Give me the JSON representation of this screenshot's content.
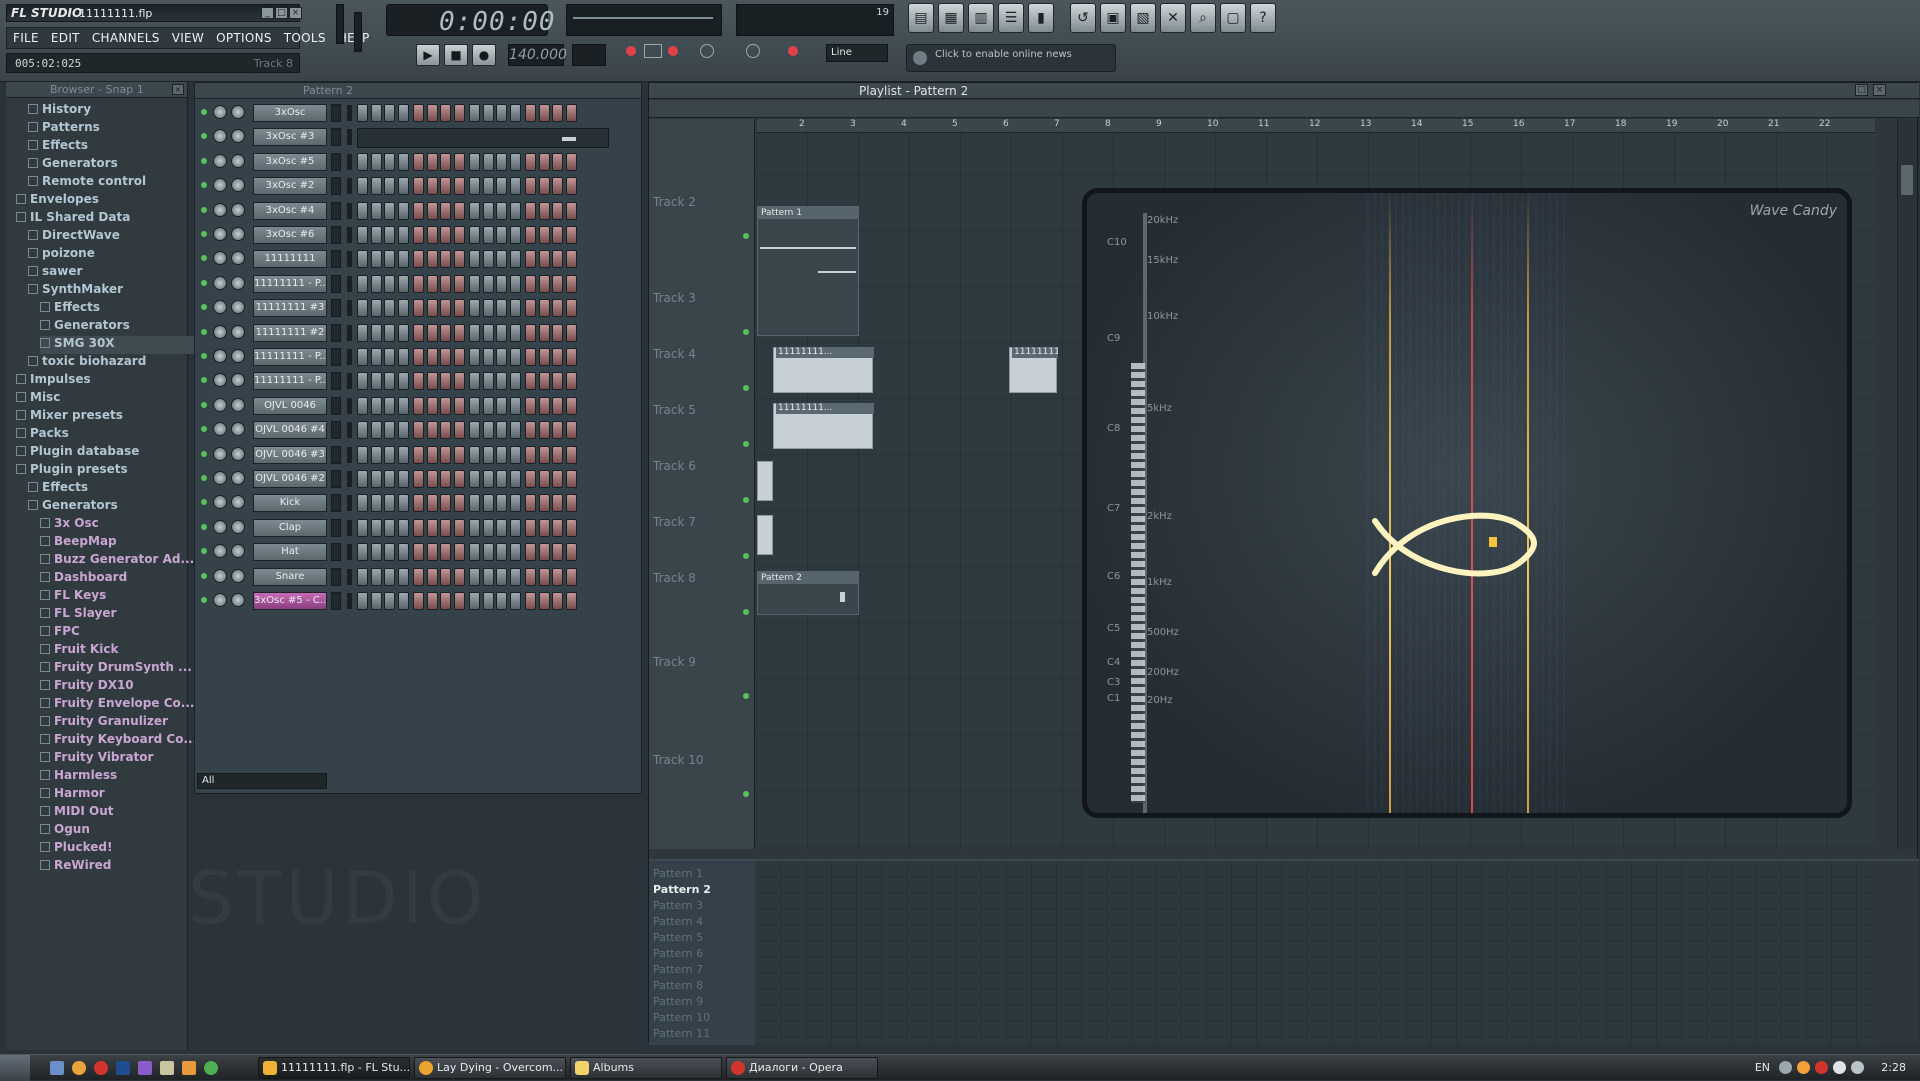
{
  "window": {
    "app_logo": "FL STUDIO",
    "project": "11111111.flp",
    "menu": [
      "FILE",
      "EDIT",
      "CHANNELS",
      "VIEW",
      "OPTIONS",
      "TOOLS",
      "HELP"
    ],
    "time_readout": "005:02:025",
    "track_readout": "Track 8"
  },
  "transport": {
    "clock": "0:00:00",
    "tempo": "140.000",
    "meters": "19",
    "snap": "Line",
    "news": "Click to enable online news",
    "play_icon": "play-icon",
    "stop_icon": "stop-icon",
    "record_icon": "record-icon"
  },
  "browser": {
    "title": "Browser - Snap 1",
    "items": [
      {
        "label": "History",
        "indent": 1
      },
      {
        "label": "Patterns",
        "indent": 1
      },
      {
        "label": "Effects",
        "indent": 1
      },
      {
        "label": "Generators",
        "indent": 1
      },
      {
        "label": "Remote control",
        "indent": 1
      },
      {
        "label": "Envelopes",
        "indent": 0
      },
      {
        "label": "IL Shared Data",
        "indent": 0
      },
      {
        "label": "DirectWave",
        "indent": 1
      },
      {
        "label": "poizone",
        "indent": 1
      },
      {
        "label": "sawer",
        "indent": 1
      },
      {
        "label": "SynthMaker",
        "indent": 1
      },
      {
        "label": "Effects",
        "indent": 2
      },
      {
        "label": "Generators",
        "indent": 2
      },
      {
        "label": "SMG 30X",
        "indent": 2
      },
      {
        "label": "toxic biohazard",
        "indent": 1
      },
      {
        "label": "Impulses",
        "indent": 0
      },
      {
        "label": "Misc",
        "indent": 0
      },
      {
        "label": "Mixer presets",
        "indent": 0
      },
      {
        "label": "Packs",
        "indent": 0
      },
      {
        "label": "Plugin database",
        "indent": 0
      },
      {
        "label": "Plugin presets",
        "indent": 0
      },
      {
        "label": "Effects",
        "indent": 1
      },
      {
        "label": "Generators",
        "indent": 1
      },
      {
        "label": "3x Osc",
        "indent": 2
      },
      {
        "label": "BeepMap",
        "indent": 2
      },
      {
        "label": "Buzz Generator Ad...",
        "indent": 2
      },
      {
        "label": "Dashboard",
        "indent": 2
      },
      {
        "label": "FL Keys",
        "indent": 2
      },
      {
        "label": "FL Slayer",
        "indent": 2
      },
      {
        "label": "FPC",
        "indent": 2
      },
      {
        "label": "Fruit Kick",
        "indent": 2
      },
      {
        "label": "Fruity DrumSynth ...",
        "indent": 2
      },
      {
        "label": "Fruity DX10",
        "indent": 2
      },
      {
        "label": "Fruity Envelope Co...",
        "indent": 2
      },
      {
        "label": "Fruity Granulizer",
        "indent": 2
      },
      {
        "label": "Fruity Keyboard Co...",
        "indent": 2
      },
      {
        "label": "Fruity Vibrator",
        "indent": 2
      },
      {
        "label": "Harmless",
        "indent": 2
      },
      {
        "label": "Harmor",
        "indent": 2
      },
      {
        "label": "MIDI Out",
        "indent": 2
      },
      {
        "label": "Ogun",
        "indent": 2
      },
      {
        "label": "Plucked!",
        "indent": 2
      },
      {
        "label": "ReWired",
        "indent": 2
      }
    ]
  },
  "channel_rack": {
    "pattern": "Pattern 2",
    "filter": "All",
    "channels": [
      "3xOsc",
      "3xOsc #3",
      "3xOsc #5",
      "3xOsc #2",
      "3xOsc #4",
      "3xOsc #6",
      "11111111",
      "11111111 - P...",
      "11111111 #3",
      "11111111 #2",
      "11111111 - P...",
      "11111111 - P...",
      "OJVL 0046",
      "OJVL 0046 #4",
      "OJVL 0046 #3",
      "OJVL 0046 #2",
      "Kick",
      "Clap",
      "Hat",
      "Snare",
      "3xOsc #5 - C..."
    ]
  },
  "playlist": {
    "title": "Playlist - Pattern 2",
    "bars": [
      "2",
      "3",
      "4",
      "5",
      "6",
      "7",
      "8",
      "9",
      "10",
      "11",
      "12",
      "13",
      "14",
      "15",
      "16",
      "17",
      "18",
      "19",
      "20",
      "21",
      "22"
    ],
    "tracks": [
      "Track 2",
      "Track 3",
      "Track 4",
      "Track 5",
      "Track 6",
      "Track 7",
      "Track 8",
      "Track 9",
      "Track 10"
    ],
    "clips": {
      "pattern1": "Pattern 1",
      "pattern2": "Pattern 2",
      "audio_a": "11111111...",
      "audio_b": "11111111...",
      "audio_c": "11111111..."
    },
    "patterns": [
      "Pattern 1",
      "Pattern 2",
      "Pattern 3",
      "Pattern 4",
      "Pattern 5",
      "Pattern 6",
      "Pattern 7",
      "Pattern 8",
      "Pattern 9",
      "Pattern 10",
      "Pattern 11"
    ]
  },
  "wave_candy": {
    "title": "Wave Candy",
    "freq_labels": [
      "20kHz",
      "15kHz",
      "10kHz",
      "5kHz",
      "2kHz",
      "1kHz",
      "500Hz",
      "200Hz",
      "20Hz"
    ],
    "note_labels": [
      "C10",
      "C9",
      "C8",
      "C7",
      "C6",
      "C5",
      "C4",
      "C3",
      "C1"
    ]
  },
  "taskbar": {
    "tasks": [
      "11111111.flp - FL Stu...",
      "Lay Dying - Overcom...",
      "Albums",
      "Диалоги - Opera"
    ],
    "lang": "EN",
    "clock": "2:28"
  },
  "colors": {
    "accent_green": "#58c35a",
    "channel_highlight": "#c76ab6",
    "fish_glow": "#fff3c0"
  }
}
